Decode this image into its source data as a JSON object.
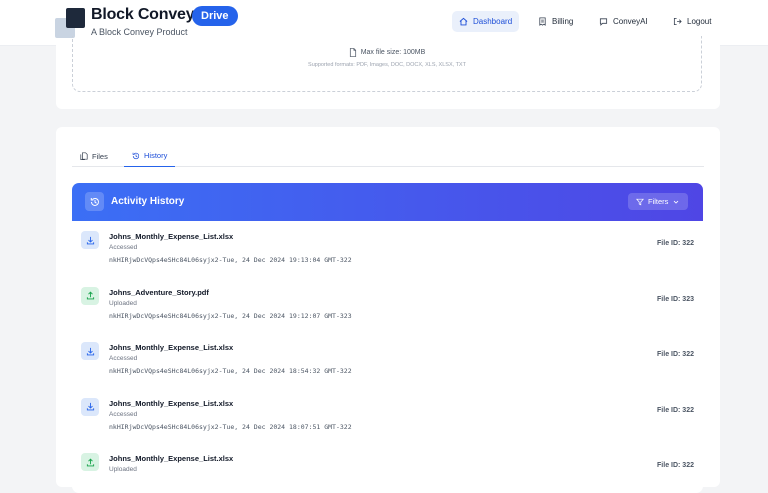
{
  "brand": {
    "name": "Block Convey",
    "badge": "Drive",
    "subtitle": "A Block Convey Product"
  },
  "nav": {
    "dashboard": "Dashboard",
    "billing": "Billing",
    "conveyai": "ConveyAI",
    "logout": "Logout"
  },
  "upload": {
    "max_size": "Max file size: 100MB",
    "formats": "Supported formats: PDF, Images, DOC, DOCX, XLS, XLSX, TXT"
  },
  "tabs": {
    "files": "Files",
    "history": "History"
  },
  "activity": {
    "title": "Activity History",
    "filters_label": "Filters",
    "rows": [
      {
        "type": "accessed",
        "name": "Johns_Monthly_Expense_List.xlsx",
        "action": "Accessed",
        "detail": "nkHIRjwDcVQps4eSHc84L06syjx2-Tue, 24 Dec 2024 19:13:04 GMT-322",
        "file_id": "File ID: 322"
      },
      {
        "type": "uploaded",
        "name": "Johns_Adventure_Story.pdf",
        "action": "Uploaded",
        "detail": "nkHIRjwDcVQps4eSHc84L06syjx2-Tue, 24 Dec 2024 19:12:07 GMT-323",
        "file_id": "File ID: 323"
      },
      {
        "type": "accessed",
        "name": "Johns_Monthly_Expense_List.xlsx",
        "action": "Accessed",
        "detail": "nkHIRjwDcVQps4eSHc84L06syjx2-Tue, 24 Dec 2024 18:54:32 GMT-322",
        "file_id": "File ID: 322"
      },
      {
        "type": "accessed",
        "name": "Johns_Monthly_Expense_List.xlsx",
        "action": "Accessed",
        "detail": "nkHIRjwDcVQps4eSHc84L06syjx2-Tue, 24 Dec 2024 18:07:51 GMT-322",
        "file_id": "File ID: 322"
      },
      {
        "type": "uploaded",
        "name": "Johns_Monthly_Expense_List.xlsx",
        "action": "Uploaded",
        "detail": "",
        "file_id": "File ID: 322"
      }
    ]
  },
  "colors": {
    "accent": "#2563eb",
    "header_gradient_start": "#3b6ff5",
    "header_gradient_end": "#4f46e5",
    "access_icon": "#2563eb",
    "upload_icon": "#16a34a"
  },
  "icons": {
    "dashboard": "home-icon",
    "billing": "receipt-icon",
    "conveyai": "chat-icon",
    "logout": "logout-icon",
    "max_size": "file-icon",
    "files_tab": "files-icon",
    "history_tab": "history-icon",
    "filters": "filter-icon",
    "accessed": "download-icon",
    "uploaded": "upload-icon"
  }
}
